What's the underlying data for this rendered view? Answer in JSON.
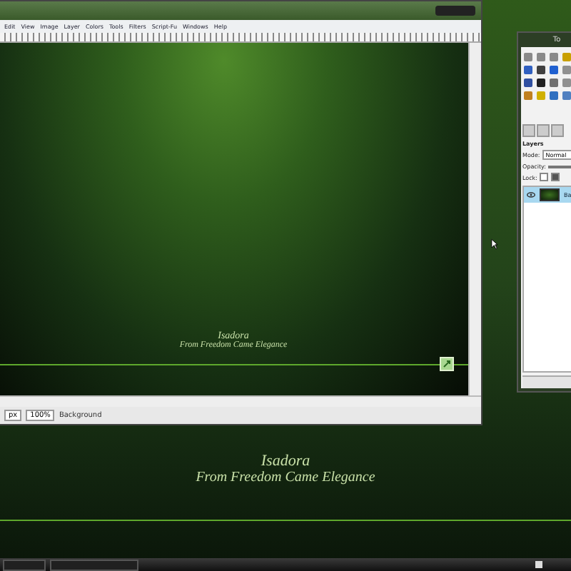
{
  "image_window": {
    "menus": [
      "Edit",
      "View",
      "Image",
      "Layer",
      "Colors",
      "Tools",
      "Filters",
      "Script-Fu",
      "Windows",
      "Help"
    ],
    "canvas": {
      "title": "Isadora",
      "subtitle": "From Freedom Came Elegance"
    },
    "status": {
      "unit": "px",
      "zoom": "100%",
      "info": "Background"
    }
  },
  "toolbox": {
    "title": "To",
    "layers_label": "Layers",
    "mode_label": "Mode:",
    "mode_value": "Normal",
    "opacity_label": "Opacity:",
    "opacity": {
      "level": 1
    },
    "lock_label": "Lock:",
    "locks": [
      {
        "checked": false
      },
      {
        "checked": true
      }
    ],
    "layers": [
      {
        "name": "Ba",
        "selected": true
      }
    ]
  },
  "desktop": {
    "title": "Isadora",
    "subtitle": "From Freedom Came Elegance"
  }
}
